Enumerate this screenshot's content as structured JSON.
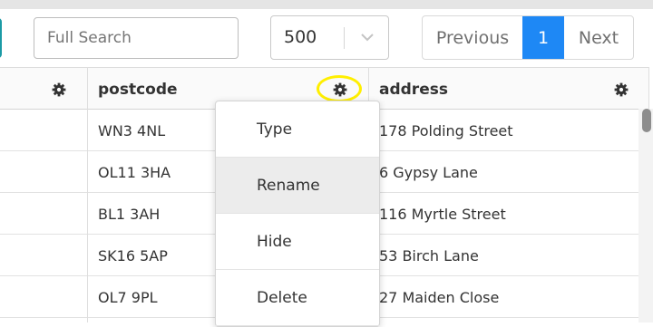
{
  "search": {
    "placeholder": "Full Search"
  },
  "page_size": {
    "value": "500"
  },
  "pagination": {
    "previous": "Previous",
    "current": "1",
    "next": "Next"
  },
  "columns": [
    {
      "label": ""
    },
    {
      "label": "postcode"
    },
    {
      "label": "address"
    }
  ],
  "rows": [
    {
      "postcode": "WN3 4NL",
      "address": "178 Polding Street"
    },
    {
      "postcode": "OL11 3HA",
      "address": "6 Gypsy Lane"
    },
    {
      "postcode": "BL1 3AH",
      "address": "116 Myrtle Street"
    },
    {
      "postcode": "SK16 5AP",
      "address": "53 Birch Lane"
    },
    {
      "postcode": "OL7 9PL",
      "address": "27 Maiden Close"
    }
  ],
  "column_menu": {
    "items": [
      "Type",
      "Rename",
      "Hide",
      "Delete"
    ],
    "active": "Rename"
  },
  "colors": {
    "accent": "#1e88f5",
    "highlight": "#ffef00",
    "teal": "#1b9aa5"
  },
  "icons": [
    "gear-icon",
    "chevron-down-icon"
  ]
}
